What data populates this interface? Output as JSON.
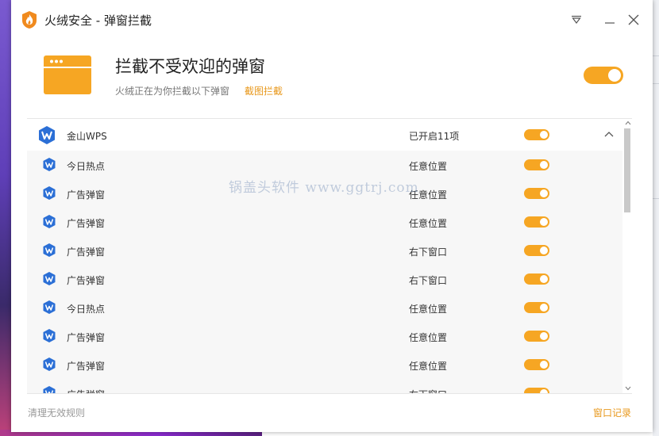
{
  "window": {
    "title": "火绒安全 - 弹窗拦截"
  },
  "titlebar_buttons": {
    "menu": "menu-triangle-icon",
    "minimize": "minimize-icon",
    "close": "close-icon"
  },
  "header": {
    "title": "拦截不受欢迎的弹窗",
    "subtitle": "火绒正在为你拦截以下弹窗",
    "link": "截图拦截",
    "master_toggle": true
  },
  "group": {
    "name": "金山WPS",
    "status": "已开启11项",
    "toggle": true,
    "icon": "wps-icon"
  },
  "rules": [
    {
      "name": "今日热点",
      "position": "任意位置",
      "enabled": true
    },
    {
      "name": "广告弹窗",
      "position": "任意位置",
      "enabled": true
    },
    {
      "name": "广告弹窗",
      "position": "任意位置",
      "enabled": true
    },
    {
      "name": "广告弹窗",
      "position": "右下窗口",
      "enabled": true
    },
    {
      "name": "广告弹窗",
      "position": "右下窗口",
      "enabled": true
    },
    {
      "name": "今日热点",
      "position": "任意位置",
      "enabled": true
    },
    {
      "name": "广告弹窗",
      "position": "任意位置",
      "enabled": true
    },
    {
      "name": "广告弹窗",
      "position": "任意位置",
      "enabled": true
    },
    {
      "name": "广告弹窗",
      "position": "右下窗口",
      "enabled": true
    }
  ],
  "watermark": "锅盖头软件 www.ggtrj.com",
  "footer": {
    "left": "清理无效规则",
    "right": "窗口记录"
  },
  "colors": {
    "accent": "#f6a623",
    "link": "#e8981c",
    "wps_blue": "#2b6fd6"
  }
}
